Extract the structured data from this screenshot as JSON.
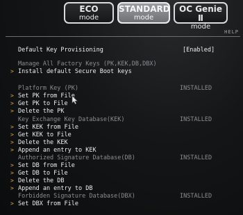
{
  "mode_bar": {
    "eco": {
      "line1": "ECO",
      "line2": "mode"
    },
    "standard": {
      "line1": "STANDARD",
      "line2": "mode"
    },
    "oc_genie": {
      "line1": "OC Genie Ⅱ",
      "line2": "mode"
    }
  },
  "help_label": "HELP",
  "settings": {
    "default_key_provisioning": {
      "label": "Default Key Provisioning",
      "value": "[Enabled]"
    }
  },
  "sections": {
    "manage_all": {
      "heading": "Manage All Factory Keys (PK,KEK,DB,DBX)",
      "items": [
        "Install default Secure Boot keys"
      ]
    },
    "platform_key": {
      "heading": "Platform Key (PK)",
      "status": "INSTALLED",
      "items": [
        "Set PK from File",
        "Get PK to File",
        "Delete the PK"
      ]
    },
    "kek": {
      "heading": "Key Exchange Key Database(KEK)",
      "status": "INSTALLED",
      "items": [
        "Set KEK from File",
        "Get KEK to File",
        "Delete the KEK",
        "Append an entry to KEK"
      ]
    },
    "db": {
      "heading": "Authorized Signature Database(DB)",
      "status": "INSTALLED",
      "items": [
        "Set DB from File",
        "Get DB to File",
        "Delete the DB",
        "Append an entry to DB"
      ]
    },
    "dbx": {
      "heading": "Forbidden Signature Database(DBX)",
      "status": "INSTALLED",
      "items": [
        "Set DBX from File"
      ]
    }
  },
  "colors": {
    "arrow": "#e0a63a",
    "heading_text": "#8b8e91",
    "item_text": "#eceef0"
  },
  "icons": {
    "menu_arrow": "chevron-right-icon",
    "pointer": "mouse-pointer-icon"
  }
}
